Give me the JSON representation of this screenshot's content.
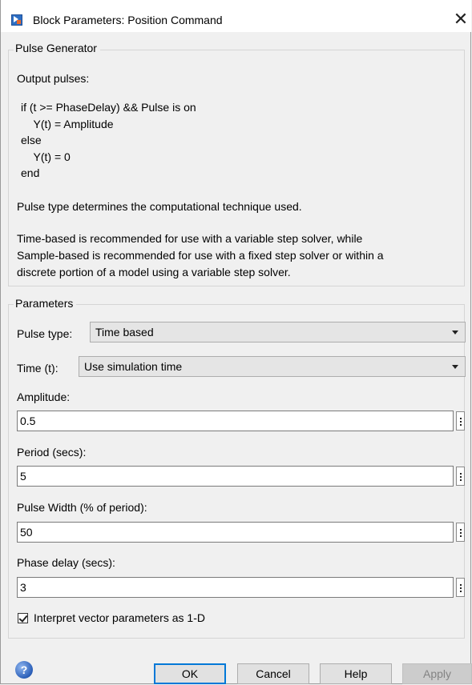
{
  "window": {
    "title": "Block Parameters: Position Command",
    "close_glyph": "✕"
  },
  "description": {
    "group_title": "Pulse Generator",
    "intro": "Output pulses:",
    "code_lines": [
      "if (t >= PhaseDelay) && Pulse is on",
      "  Y(t) = Amplitude",
      "else",
      "  Y(t) = 0",
      "end"
    ],
    "note1": "Pulse type determines the computational technique used.",
    "note2_lines": [
      "Time-based is recommended for use with a variable step solver, while",
      "Sample-based is recommended for use with a fixed step solver or within a",
      "discrete portion of a model using a variable step solver."
    ]
  },
  "parameters": {
    "group_title": "Parameters",
    "pulse_type": {
      "label": "Pulse type:",
      "value": "Time based"
    },
    "time": {
      "label": "Time (t):",
      "value": "Use simulation time"
    },
    "amplitude": {
      "label": "Amplitude:",
      "value": "0.5"
    },
    "period": {
      "label": "Period (secs):",
      "value": "5"
    },
    "pulse_width": {
      "label": "Pulse Width (% of period):",
      "value": "50"
    },
    "phase_delay": {
      "label": "Phase delay (secs):",
      "value": "3"
    },
    "interpret_vector": {
      "label": "Interpret vector parameters as 1-D",
      "checked": true
    }
  },
  "buttons": {
    "help_icon_glyph": "?",
    "ok": "OK",
    "cancel": "Cancel",
    "help": "Help",
    "apply": "Apply"
  },
  "colors": {
    "default_button_border": "#0078d7",
    "dialog_background": "#f0f0f0"
  }
}
